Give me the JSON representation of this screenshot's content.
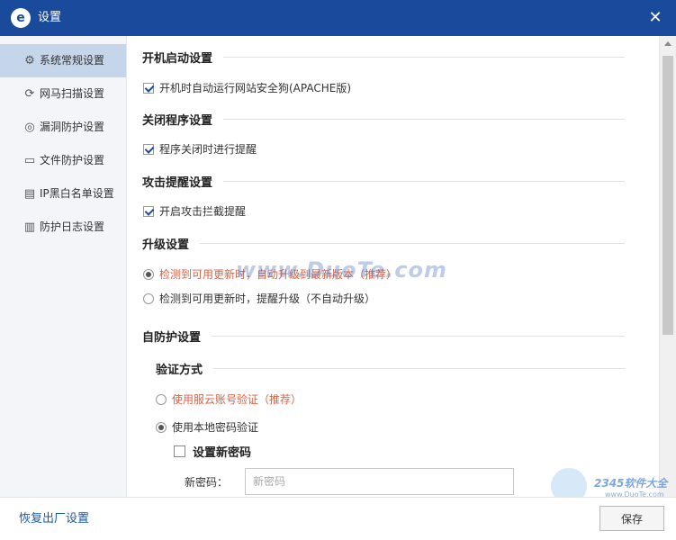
{
  "window": {
    "title": "设置",
    "logo": "e"
  },
  "sidebar": {
    "items": [
      {
        "label": "系统常规设置",
        "icon": "gear-icon",
        "glyph": "⚙",
        "active": true
      },
      {
        "label": "网马扫描设置",
        "icon": "refresh-icon",
        "glyph": "⟳",
        "active": false
      },
      {
        "label": "漏洞防护设置",
        "icon": "target-icon",
        "glyph": "◎",
        "active": false
      },
      {
        "label": "文件防护设置",
        "icon": "folder-icon",
        "glyph": "▭",
        "active": false
      },
      {
        "label": "IP黑白名单设置",
        "icon": "list-icon",
        "glyph": "▤",
        "active": false
      },
      {
        "label": "防护日志设置",
        "icon": "log-icon",
        "glyph": "▥",
        "active": false
      }
    ]
  },
  "sections": {
    "startup": {
      "title": "开机启动设置",
      "option": "开机时自动运行网站安全狗(APACHE版)",
      "checked": true
    },
    "close": {
      "title": "关闭程序设置",
      "option": "程序关闭时进行提醒",
      "checked": true
    },
    "attack": {
      "title": "攻击提醒设置",
      "option": "开启攻击拦截提醒",
      "checked": true
    },
    "upgrade": {
      "title": "升级设置",
      "options": [
        {
          "label": "检测到可用更新时，自动升级到最新版本（推荐）",
          "selected": true
        },
        {
          "label": "检测到可用更新时，提醒升级（不自动升级）",
          "selected": false
        }
      ]
    },
    "selfprotect": {
      "title": "自防护设置",
      "subtitle": "验证方式",
      "options": [
        {
          "label": "使用服云账号验证（推荐）",
          "selected": false
        },
        {
          "label": "使用本地密码验证",
          "selected": true
        }
      ],
      "new_password_label": "设置新密码",
      "password_field_label": "新密码：",
      "password_placeholder": "新密码"
    }
  },
  "footer": {
    "reset_label": "恢复出厂设置",
    "save_label": "保存"
  },
  "watermarks": {
    "center": "www.DuoTe.com",
    "corner": "2345软件大全",
    "corner_url": "www.DuoTe.com"
  },
  "colors": {
    "title_bar": "#1a4a9c",
    "accent_link": "#1a5aa8",
    "highlight_text": "#e06040"
  }
}
